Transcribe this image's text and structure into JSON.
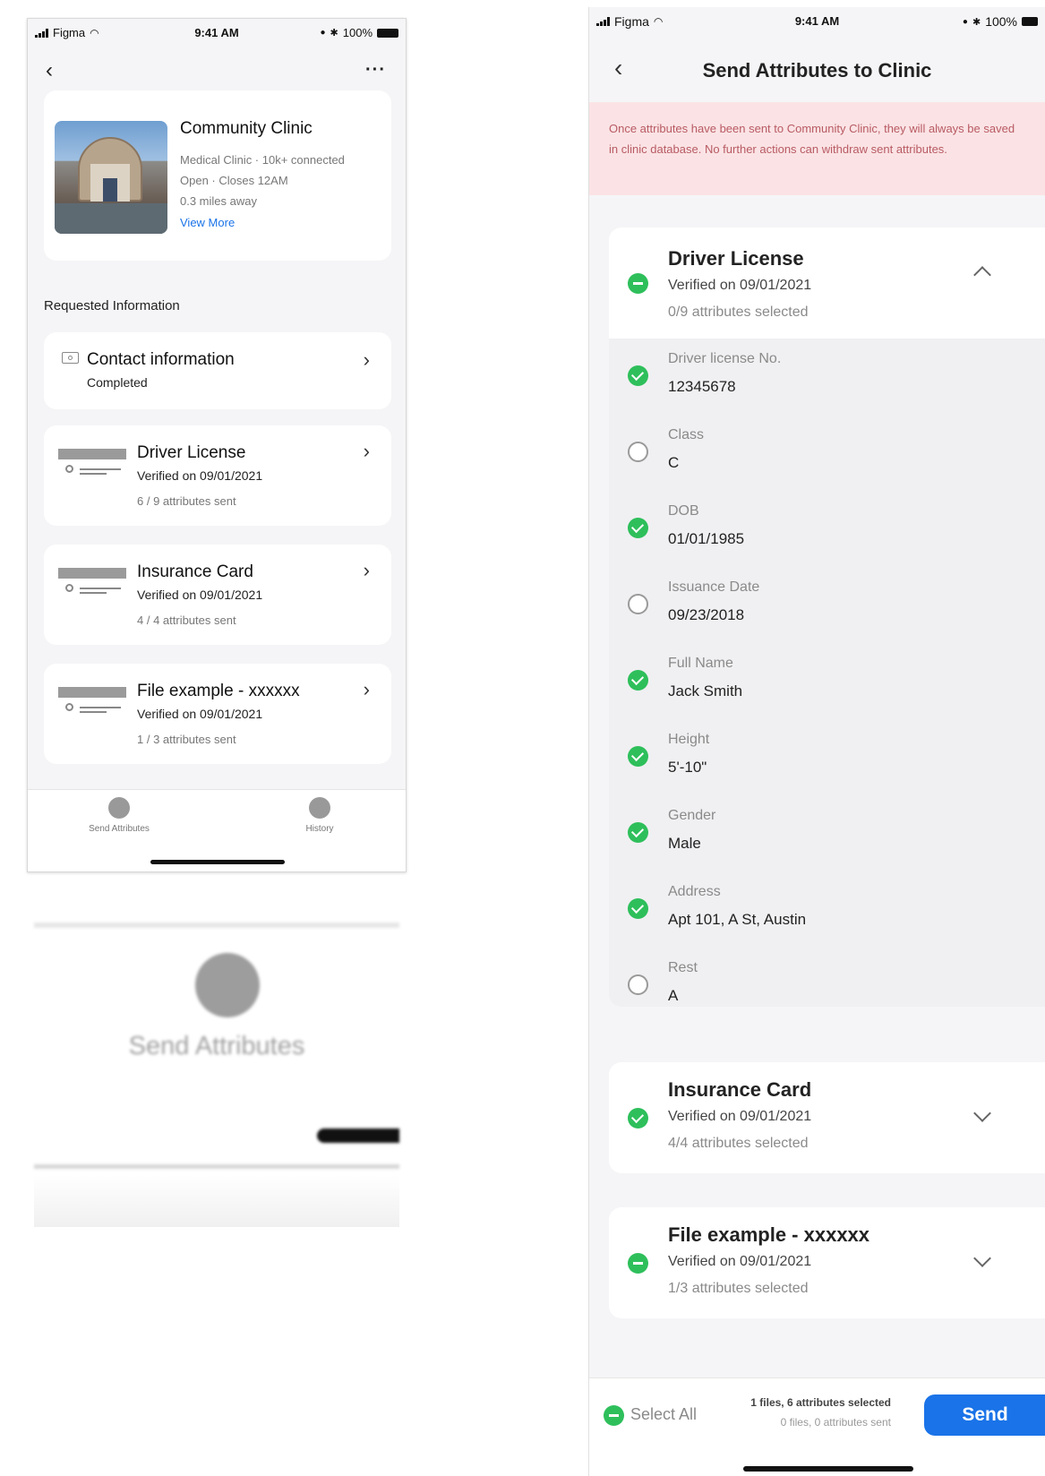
{
  "status_bar": {
    "carrier": "Figma",
    "time": "9:41 AM",
    "battery": "100%"
  },
  "screen1": {
    "more_label": "···",
    "clinic": {
      "name": "Community Clinic",
      "type_line": "Medical Clinic · 10k+ connected",
      "hours_line": "Open · Closes 12AM",
      "distance_line": "0.3 miles away",
      "view_more": "View More"
    },
    "section_title": "Requested Information",
    "contact": {
      "title": "Contact information",
      "status": "Completed"
    },
    "documents": [
      {
        "title": "Driver License",
        "verified": "Verified on 09/01/2021",
        "sent": "6 / 9 attributes sent"
      },
      {
        "title": "Insurance Card",
        "verified": "Verified on 09/01/2021",
        "sent": "4 / 4 attributes sent"
      },
      {
        "title": "File example - xxxxxx",
        "verified": "Verified on 09/01/2021",
        "sent": "1 / 3 attributes sent"
      }
    ],
    "tabs": [
      {
        "label": "Send Attributes"
      },
      {
        "label": "History"
      }
    ]
  },
  "zoom": {
    "label": "Send Attributes"
  },
  "screen2": {
    "title": "Send Attributes to Clinic",
    "warning": "Once attributes have been sent to Community Clinic, they will always be saved in clinic database. No further actions can withdraw sent attributes.",
    "sections": [
      {
        "title": "Driver License",
        "verified": "Verified on 09/01/2021",
        "selected": "0/9 attributes selected"
      },
      {
        "title": "Insurance Card",
        "verified": "Verified on 09/01/2021",
        "selected": "4/4 attributes selected"
      },
      {
        "title": "File example - xxxxxx",
        "verified": "Verified on 09/01/2021",
        "selected": "1/3 attributes selected"
      }
    ],
    "attributes": [
      {
        "label": "Driver license No.",
        "value": "12345678",
        "checked": true
      },
      {
        "label": "Class",
        "value": "C",
        "checked": false
      },
      {
        "label": "DOB",
        "value": "01/01/1985",
        "checked": true
      },
      {
        "label": "Issuance Date",
        "value": "09/23/2018",
        "checked": false
      },
      {
        "label": "Full Name",
        "value": "Jack Smith",
        "checked": true
      },
      {
        "label": "Height",
        "value": "5'-10\"",
        "checked": true
      },
      {
        "label": "Gender",
        "value": "Male",
        "checked": true
      },
      {
        "label": "Address",
        "value": "Apt 101, A St, Austin",
        "checked": true
      },
      {
        "label": "Rest",
        "value": "A",
        "checked": false
      }
    ],
    "footer": {
      "select_all": "Select All",
      "summary_selected": "1 files, 6 attributes selected",
      "summary_sent": "0 files, 0 attributes sent",
      "send": "Send"
    }
  },
  "colors": {
    "accent": "#1a73e8",
    "success": "#2ebf5b",
    "warning_bg": "#fbe3e5"
  }
}
